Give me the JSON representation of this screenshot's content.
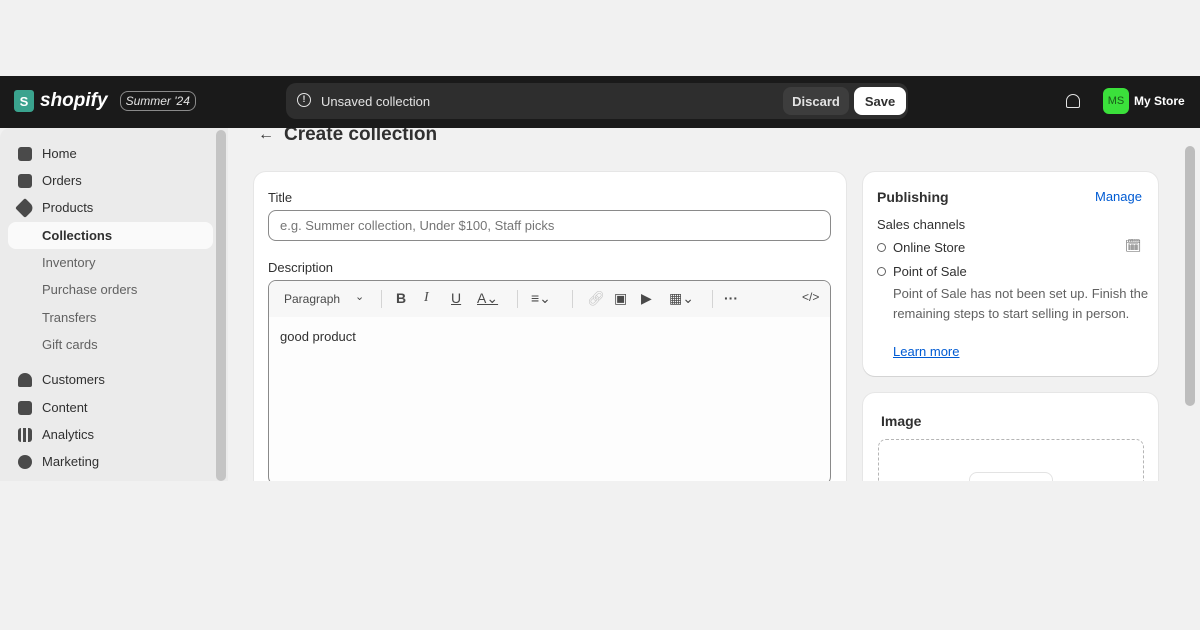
{
  "topbar": {
    "brand": "shopify",
    "edition": "Summer '24",
    "unsaved_text": "Unsaved collection",
    "discard": "Discard",
    "save": "Save",
    "avatar_initials": "MS",
    "store_name": "My Store",
    "avatar_color": "#3be03b"
  },
  "sidebar": {
    "items": [
      {
        "label": "Home",
        "icon": "home-icon"
      },
      {
        "label": "Orders",
        "icon": "inbox-icon"
      },
      {
        "label": "Products",
        "icon": "tag-icon"
      },
      {
        "label": "Collections",
        "active": true
      },
      {
        "label": "Inventory"
      },
      {
        "label": "Purchase orders"
      },
      {
        "label": "Transfers"
      },
      {
        "label": "Gift cards"
      },
      {
        "label": "Customers",
        "icon": "person-icon"
      },
      {
        "label": "Content",
        "icon": "content-icon"
      },
      {
        "label": "Analytics",
        "icon": "bar-chart-icon"
      },
      {
        "label": "Marketing",
        "icon": "target-icon"
      }
    ]
  },
  "page": {
    "title": "Create collection"
  },
  "form": {
    "title_label": "Title",
    "title_placeholder": "e.g. Summer collection, Under $100, Staff picks",
    "description_label": "Description",
    "format": "Paragraph",
    "description_value": "good product"
  },
  "publishing": {
    "title": "Publishing",
    "manage": "Manage",
    "sales_channels": "Sales channels",
    "channels": [
      "Online Store",
      "Point of Sale"
    ],
    "pos_note": "Point of Sale has not been set up. Finish the remaining steps to start selling in person.",
    "learn_more": "Learn more"
  },
  "image": {
    "title": "Image"
  }
}
